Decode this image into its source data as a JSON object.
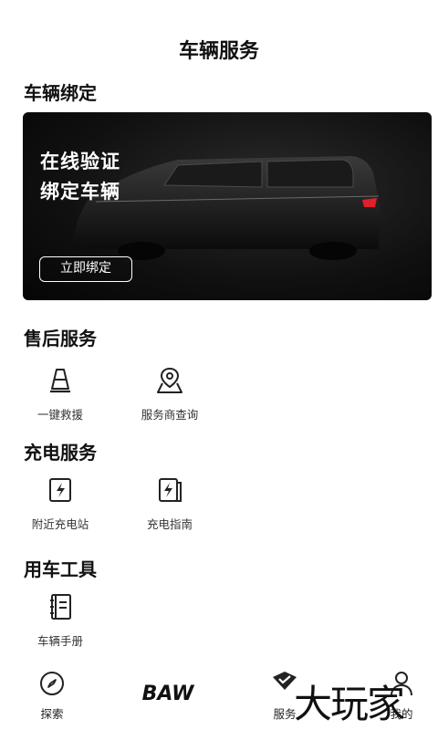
{
  "header": {
    "title": "车辆服务"
  },
  "vehicle_binding": {
    "section_title": "车辆绑定",
    "banner_line1": "在线验证",
    "banner_line2": "绑定车辆",
    "bind_button": "立即绑定"
  },
  "after_sales": {
    "section_title": "售后服务",
    "items": [
      {
        "label": "一键救援",
        "icon": "cone-icon"
      },
      {
        "label": "服务商查询",
        "icon": "map-pin-icon"
      }
    ]
  },
  "charging": {
    "section_title": "充电服务",
    "items": [
      {
        "label": "附近充电站",
        "icon": "charging-icon"
      },
      {
        "label": "充电指南",
        "icon": "charging-guide-icon"
      }
    ]
  },
  "tools": {
    "section_title": "用车工具",
    "items": [
      {
        "label": "车辆手册",
        "icon": "manual-icon"
      }
    ]
  },
  "tabbar": {
    "tabs": [
      {
        "label": "探索",
        "icon": "compass-icon"
      },
      {
        "label": "服务",
        "icon": "service-icon"
      },
      {
        "label": "我的",
        "icon": "profile-icon"
      }
    ],
    "brand_logo": "BAW"
  },
  "watermark": "大玩家",
  "colors": {
    "banner_bg": "#101010",
    "accent_red": "#e0202a",
    "text": "#111111"
  }
}
